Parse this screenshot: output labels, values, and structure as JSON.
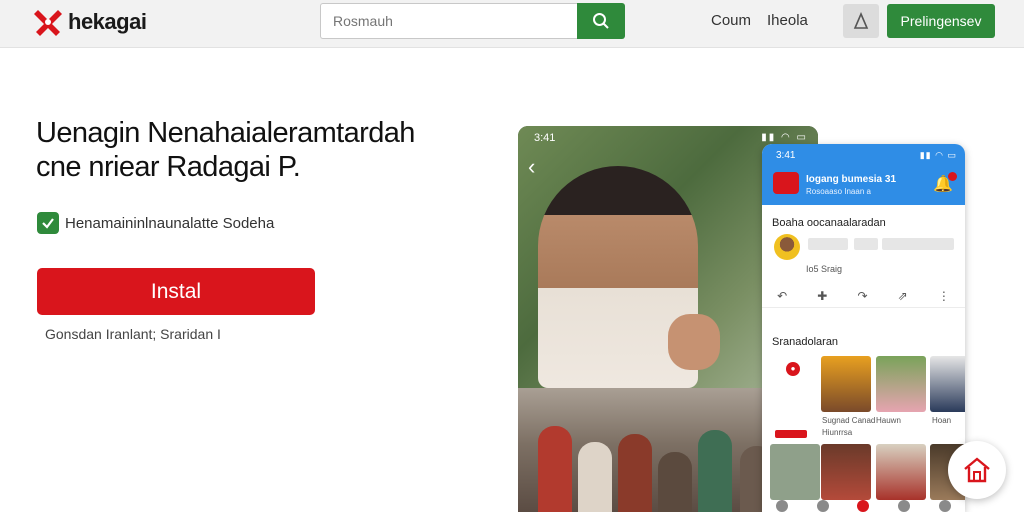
{
  "header": {
    "brand": "hekagai",
    "search_placeholder": "Rosmauh",
    "nav": [
      "Coum",
      "Iheola"
    ],
    "cta_label": "Prelingensev"
  },
  "hero": {
    "headline_line1": "Uenagin Nenahaialeramtardah",
    "headline_line2": "cne nriear Radagai P.",
    "checkbox_label": "Henamaininlnaunalatte Sodeha",
    "install_label": "Instal",
    "sub_note": "Gonsdan Iranlant; Sraridan I"
  },
  "phone_back": {
    "status_time": "3:41"
  },
  "phone_front": {
    "status_time": "3:41",
    "header_title": "Iogang bumesia 31",
    "header_sub": "Rosoaaso Inaan a",
    "section1": "Boaha oocanaalaradan",
    "post_meta": "Io5 Sraig",
    "section2": "Sranadolaran",
    "thumb_captions": [
      "Sugnad Canad",
      "Hauwn",
      "Hoan",
      "Hiunrrsa"
    ]
  },
  "colors": {
    "brand_red": "#d9151c",
    "accent_green": "#2f8a3b",
    "app_blue": "#2f8de6"
  }
}
